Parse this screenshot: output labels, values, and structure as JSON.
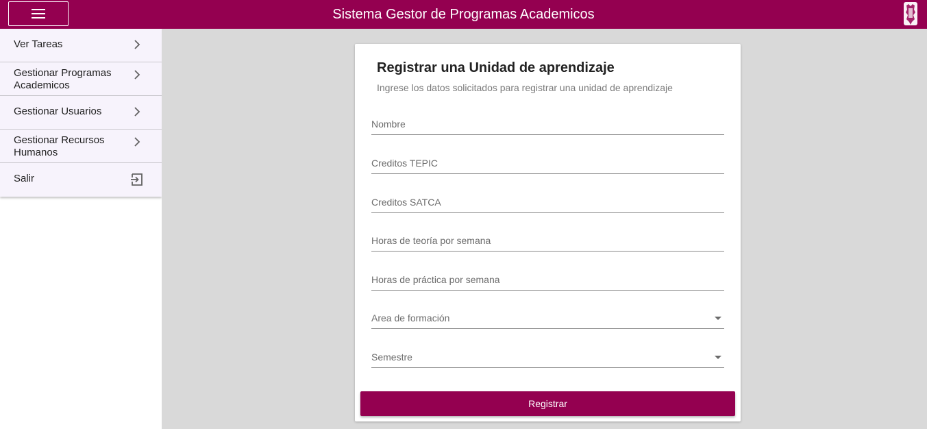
{
  "app": {
    "title": "Sistema Gestor de Programas Academicos",
    "brand_color": "#940050"
  },
  "sidebar": {
    "items": [
      {
        "label": "Ver Tareas",
        "icon": "chevron-right-icon"
      },
      {
        "label": "Gestionar Programas Academicos",
        "icon": "chevron-right-icon"
      },
      {
        "label": "Gestionar Usuarios",
        "icon": "chevron-right-icon"
      },
      {
        "label": "Gestionar Recursos Humanos",
        "icon": "chevron-right-icon"
      },
      {
        "label": "Salir",
        "icon": "exit-icon"
      }
    ]
  },
  "form": {
    "title": "Registrar una Unidad de aprendizaje",
    "subtitle": "Ingrese los datos solicitados para registrar una unidad de aprendizaje",
    "fields": {
      "nombre": {
        "placeholder": "Nombre",
        "value": ""
      },
      "creditos_tepic": {
        "placeholder": "Creditos TEPIC",
        "value": ""
      },
      "creditos_satca": {
        "placeholder": "Creditos SATCA",
        "value": ""
      },
      "horas_teoria": {
        "placeholder": "Horas de teoría por semana",
        "value": ""
      },
      "horas_practica": {
        "placeholder": "Horas de práctica por semana",
        "value": ""
      }
    },
    "selects": {
      "area_formacion": {
        "label": "Area de formación",
        "icon": "dropdown-arrow-icon"
      },
      "semestre": {
        "label": "Semestre",
        "icon": "dropdown-arrow-icon"
      }
    },
    "submit_label": "Registrar"
  }
}
